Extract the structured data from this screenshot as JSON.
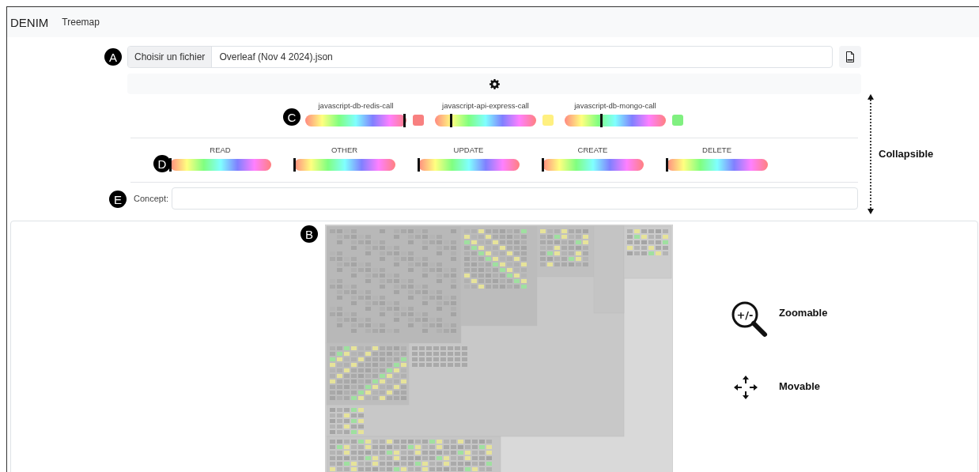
{
  "navbar": {
    "brand": "DENIM",
    "links": [
      {
        "label": "Treemap"
      }
    ]
  },
  "file_input": {
    "button": "Choisir un fichier",
    "value": "Overleaf (Nov 4 2024).json"
  },
  "concept_sliders": [
    {
      "label": "javascript-db-redis-call",
      "level": 0.98,
      "color": "#f88080"
    },
    {
      "label": "javascript-api-express-call",
      "level": 0.16,
      "color": "#fff080"
    },
    {
      "label": "javascript-db-mongo-call",
      "level": 0.36,
      "color": "#80f080"
    }
  ],
  "operation_sliders": [
    {
      "label": "READ",
      "level": 0
    },
    {
      "label": "OTHER",
      "level": 0
    },
    {
      "label": "UPDATE",
      "level": 0
    },
    {
      "label": "CREATE",
      "level": 0
    },
    {
      "label": "DELETE",
      "level": 0
    }
  ],
  "concept_field": {
    "label": "Concept:"
  },
  "annotations": {
    "markers": [
      "A",
      "C",
      "D",
      "E",
      "B"
    ],
    "collapsible": "Collapsible",
    "zoom_icon_text": "+/-",
    "zoomable": "Zoomable",
    "movable": "Movable"
  }
}
